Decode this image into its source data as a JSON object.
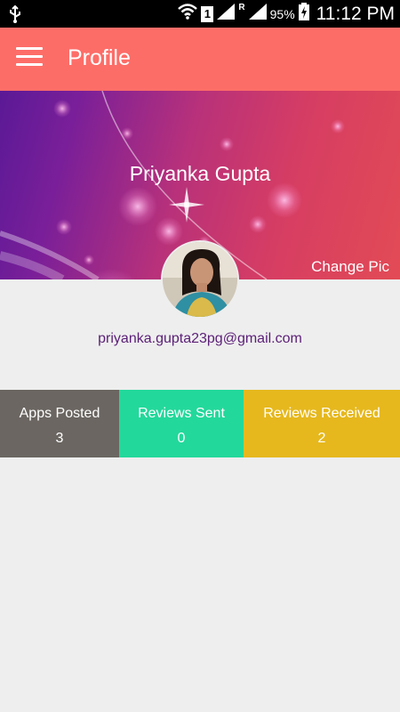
{
  "status_bar": {
    "sim": "1",
    "roaming": "R",
    "battery_percent": "95%",
    "time": "11:12 PM"
  },
  "app_bar": {
    "title": "Profile"
  },
  "profile": {
    "name": "Priyanka Gupta",
    "change_pic_label": "Change Pic",
    "email": "priyanka.gupta23pg@gmail.com"
  },
  "stats": [
    {
      "label": "Apps Posted",
      "count": "3",
      "color": "#6b6661"
    },
    {
      "label": "Reviews Sent",
      "count": "0",
      "color": "#23d89b"
    },
    {
      "label": "Reviews Received",
      "count": "2",
      "color": "#e6b81e"
    }
  ],
  "colors": {
    "app_bar": "#fd6d68",
    "email_text": "#5b1f77",
    "background": "#eeeeee"
  }
}
